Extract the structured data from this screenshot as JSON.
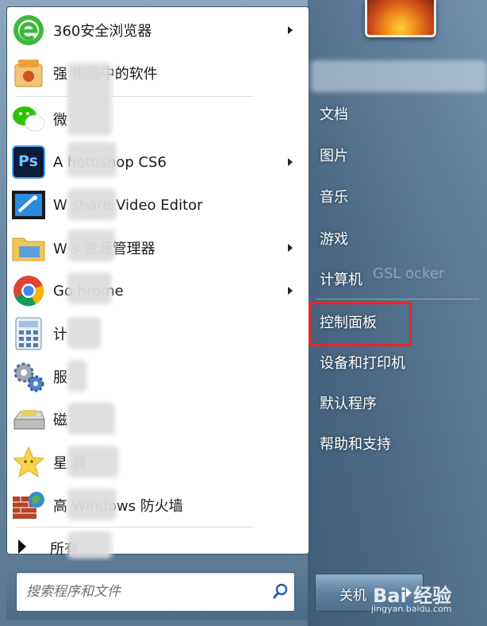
{
  "programs": [
    {
      "label": "360安全浏览器",
      "icon": "360-browser-icon",
      "has_arrow": true
    },
    {
      "label": "强 电脑中的软件",
      "icon": "software-manager-icon",
      "has_arrow": false
    },
    {
      "label": "微",
      "icon": "wechat-icon",
      "has_arrow": false
    },
    {
      "label": "A hotoshop CS6",
      "icon": "photoshop-icon",
      "has_arrow": true
    },
    {
      "label": "W share Video Editor",
      "icon": "video-editor-icon",
      "has_arrow": false
    },
    {
      "label": "W s 资源管理器",
      "icon": "file-explorer-icon",
      "has_arrow": true
    },
    {
      "label": "Go hrome",
      "icon": "chrome-icon",
      "has_arrow": true
    },
    {
      "label": "计",
      "icon": "calculator-icon",
      "has_arrow": false
    },
    {
      "label": "服",
      "icon": "services-icon",
      "has_arrow": false
    },
    {
      "label": "磁",
      "icon": "disk-icon",
      "has_arrow": false
    },
    {
      "label": "星 器",
      "icon": "star-icon",
      "has_arrow": false
    },
    {
      "label": "高 Windows 防火墙",
      "icon": "firewall-icon",
      "has_arrow": false
    }
  ],
  "all_programs": {
    "label": "所有"
  },
  "search": {
    "placeholder": "搜索程序和文件"
  },
  "right_menu": {
    "items": [
      {
        "label": "文档"
      },
      {
        "label": "图片"
      },
      {
        "label": "音乐"
      },
      {
        "label": "游戏"
      },
      {
        "label": "计算机"
      },
      {
        "label": "控制面板"
      },
      {
        "label": "设备和打印机"
      },
      {
        "label": "默认程序"
      },
      {
        "label": "帮助和支持"
      }
    ],
    "background_hint": "GSL ocker"
  },
  "shutdown": {
    "label": "关机"
  },
  "watermark": {
    "brand": "Bai 经验",
    "url": "jingyan.baidu.com"
  },
  "colors": {
    "highlight": "#e8262a",
    "menu_text": "#ffffff",
    "program_text": "#1a1a1a"
  }
}
